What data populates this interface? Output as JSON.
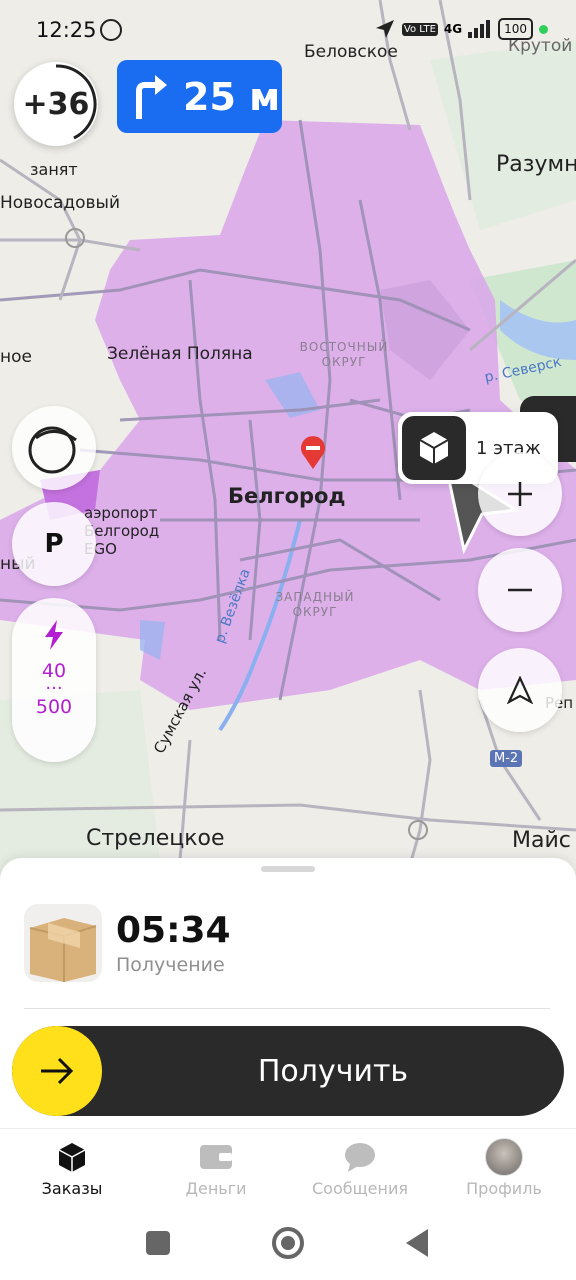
{
  "status_bar": {
    "time": "12:25",
    "network": "4G",
    "volte": "Vo LTE",
    "battery": "100"
  },
  "map": {
    "labels": {
      "belovskoe": "Беловское",
      "krutoy": "Крутой",
      "razumnoe": "Разумн",
      "novosadovy": "Новосадовый",
      "zelenaya_polyana": "Зелёная Поляна",
      "noe": "ное",
      "vostochny": "ВОСТОЧНЫЙ ОКРУГ",
      "seversky": "р. Северск",
      "belgorod": "Белгород",
      "airport": "аэропорт Белгород EGO",
      "ny": "ный",
      "zapadny": "ЗАПАДНЫЙ ОКРУГ",
      "vezelka": "р. Везёлка",
      "sumskaya": "Сумская ул.",
      "m2": "М-2",
      "rep": "Реп",
      "streletskoe": "Стрелецкое",
      "mays": "Майс"
    },
    "colors": {
      "zone": "#d9a4ea",
      "road": "#9a8fb3",
      "water": "#9fb4ef"
    }
  },
  "overlay": {
    "speed_value": "+36",
    "status": "занят",
    "maneuver_distance": "25 м",
    "floor_label": "1 этаж",
    "surge_top": "40",
    "surge_dots": "···",
    "surge_bottom": "500",
    "parking": "P"
  },
  "order": {
    "time": "05:34",
    "subtitle": "Получение",
    "action_label": "Получить"
  },
  "tabs": [
    {
      "label": "Заказы",
      "icon": "package-icon",
      "active": true
    },
    {
      "label": "Деньги",
      "icon": "wallet-icon",
      "active": false
    },
    {
      "label": "Сообщения",
      "icon": "chat-icon",
      "active": false
    },
    {
      "label": "Профиль",
      "icon": "avatar-icon",
      "active": false
    }
  ],
  "accent_colors": {
    "brand_yellow": "#ffe01a",
    "maneuver_blue": "#1a6cf0",
    "surge_purple": "#b31fd0"
  }
}
